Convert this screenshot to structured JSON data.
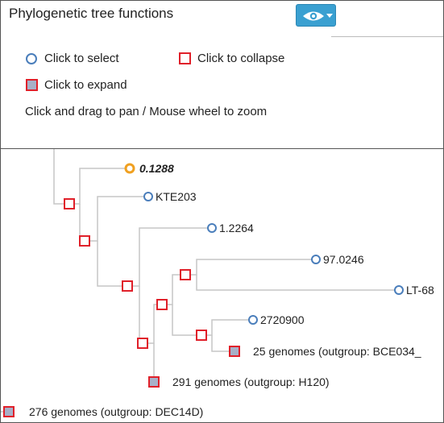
{
  "panel": {
    "title": "Phylogenetic tree functions"
  },
  "toolbar": {
    "eye_icon": "eye-icon",
    "dropdown_icon": "caret-down-icon"
  },
  "legend": {
    "select_label": "Click to select",
    "collapse_label": "Click to collapse",
    "expand_label": "Click to expand",
    "pan_zoom_hint": "Click and drag to pan / Mouse wheel to zoom"
  },
  "tree": {
    "leaves": [
      {
        "label": "0.1288",
        "selected": true
      },
      {
        "label": "KTE203",
        "selected": false
      },
      {
        "label": "1.2264",
        "selected": false
      },
      {
        "label": "97.0246",
        "selected": false
      },
      {
        "label": "LT-68",
        "selected": false
      },
      {
        "label": "2720900",
        "selected": false
      }
    ],
    "collapsed_groups": [
      {
        "label": "25 genomes (outgroup: BCE034_"
      },
      {
        "label": "291 genomes (outgroup: H120)"
      },
      {
        "label": "276 genomes (outgroup: DEC14D)"
      }
    ]
  },
  "colors": {
    "select_circle": "#4a7ebb",
    "selected_leaf": "#f0a020",
    "collapse_square": "#e0202a",
    "expand_fill": "#a8b0c8",
    "branch": "#c6c6c6",
    "eye_button": "#3aa0d1"
  }
}
